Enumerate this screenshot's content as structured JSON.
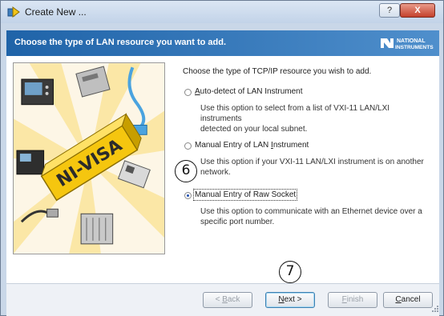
{
  "window": {
    "title": "Create New ...",
    "help_glyph": "?",
    "close_glyph": "X"
  },
  "header": {
    "title": "Choose the type of LAN resource you want to add.",
    "logo_line1": "NATIONAL",
    "logo_line2": "INSTRUMENTS"
  },
  "art": {
    "product_text": "NI-VISA"
  },
  "main": {
    "prompt": "Choose the type of TCP/IP resource you wish to add.",
    "options": [
      {
        "mnemonic": "A",
        "label_rest": "uto-detect of LAN Instrument",
        "description_1": "Use this option to select from a list of VXI-11 LAN/LXI instruments",
        "description_2": "detected on your local subnet.",
        "selected": false
      },
      {
        "label_pre": "Manual Entry of LAN ",
        "mnemonic": "I",
        "label_post": "nstrument",
        "description_1": "Use this option if your VXI-11 LAN/LXI instrument is on another",
        "description_2": "network.",
        "selected": false
      },
      {
        "label": "Manual Entry of Raw Socket",
        "description_1": "Use this option to communicate with an Ethernet device over a",
        "description_2": "specific port number.",
        "selected": true
      }
    ]
  },
  "footer": {
    "back": {
      "pre": "< ",
      "mnemonic": "B",
      "rest": "ack",
      "enabled": false
    },
    "next": {
      "mnemonic": "N",
      "rest": "ext >",
      "enabled": true
    },
    "finish": {
      "mnemonic": "F",
      "rest": "inish",
      "enabled": false
    },
    "cancel": {
      "mnemonic": "C",
      "rest": "ancel",
      "enabled": true
    }
  },
  "callouts": {
    "step6": "6",
    "step7": "7"
  },
  "colors": {
    "header_blue": "#1f63a8",
    "radio_selected": "#1f4fb0",
    "close_red": "#c4412c"
  }
}
